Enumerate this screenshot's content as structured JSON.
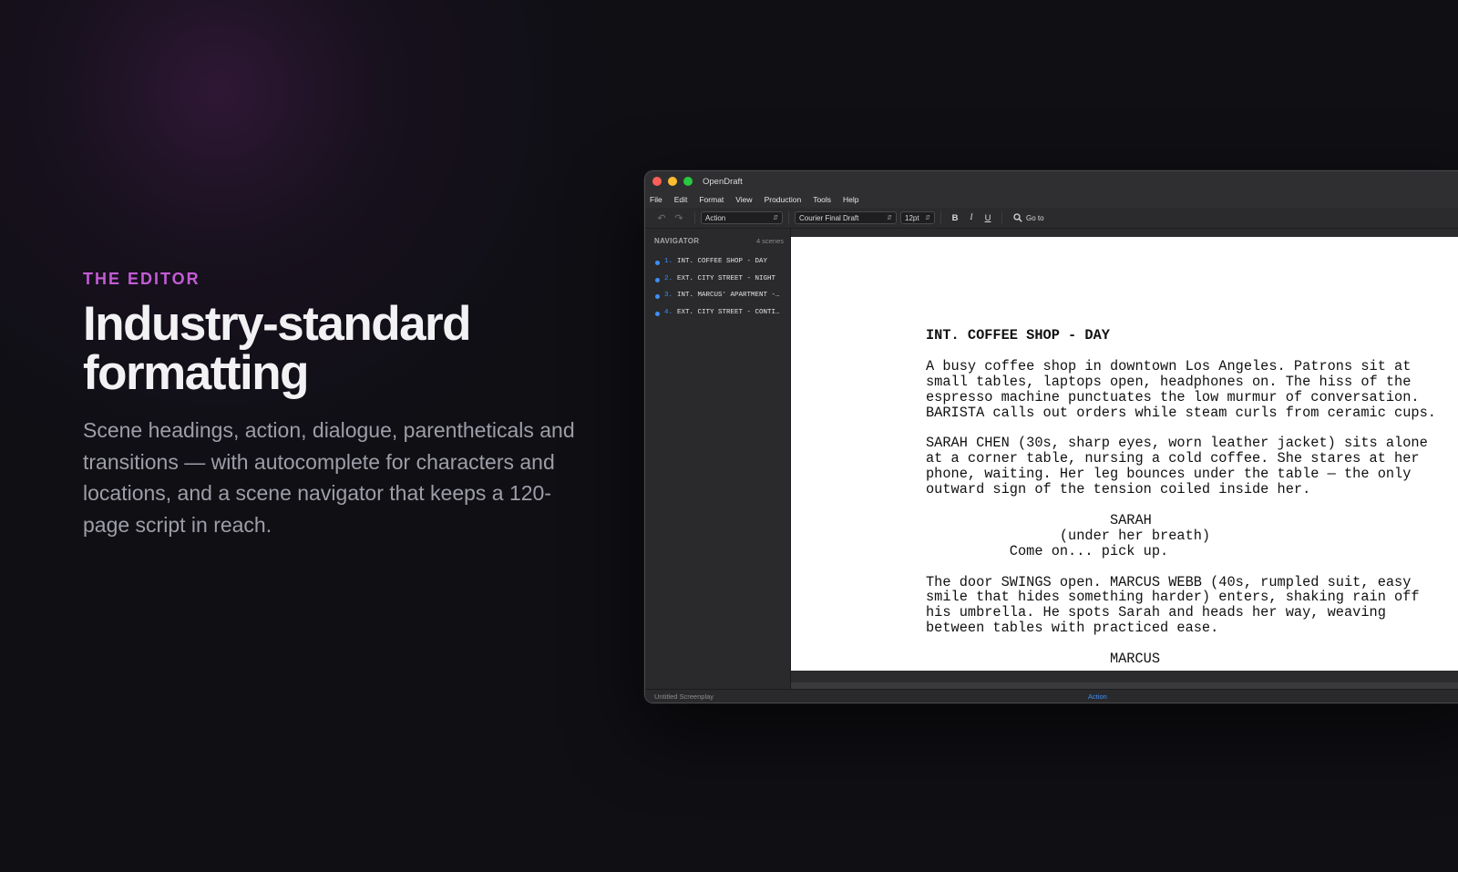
{
  "hero": {
    "eyebrow": "THE EDITOR",
    "headline_line1": "Industry-standard",
    "headline_line2": "formatting",
    "body": "Scene headings, action, dialogue, parentheticals and transitions — with autocomplete for characters and locations, and a scene navigator that keeps a 120-page script in reach."
  },
  "window": {
    "title": "OpenDraft",
    "traffic_lights": [
      "close",
      "minimize",
      "zoom"
    ]
  },
  "menu": [
    "File",
    "Edit",
    "Format",
    "View",
    "Production",
    "Tools",
    "Help"
  ],
  "toolbar": {
    "undo_icon": "undo-icon",
    "redo_icon": "redo-icon",
    "element_type": "Action",
    "font": "Courier Final Draft",
    "font_size": "12pt",
    "bold": "B",
    "italic": "I",
    "underline": "U",
    "search_icon": "search-icon",
    "goto_label": "Go to"
  },
  "navigator": {
    "title": "NAVIGATOR",
    "count": "4 scenes",
    "scenes": [
      {
        "num": "1.",
        "name": "INT. COFFEE SHOP - DAY"
      },
      {
        "num": "2.",
        "name": "EXT. CITY STREET - NIGHT"
      },
      {
        "num": "3.",
        "name": "INT. MARCUS' APARTMENT - NIGHT"
      },
      {
        "num": "4.",
        "name": "EXT. CITY STREET - CONTINUOUS"
      }
    ]
  },
  "script": {
    "heading": "INT. COFFEE SHOP - DAY",
    "action1": [
      "A busy coffee shop in downtown Los Angeles. Patrons sit at",
      "small tables, laptops open, headphones on. The hiss of the",
      "espresso machine punctuates the low murmur of conversation.",
      "BARISTA calls out orders while steam curls from ceramic cups."
    ],
    "action2": [
      "SARAH CHEN (30s, sharp eyes, worn leather jacket) sits alone",
      "at a corner table, nursing a cold coffee. She stares at her",
      "phone, waiting. Her leg bounces under the table — the only",
      "outward sign of the tension coiled inside her."
    ],
    "character1": "SARAH",
    "parenthetical1": "(under her breath)",
    "dialogue1": "Come on... pick up.",
    "action3": [
      "The door SWINGS open. MARCUS WEBB (40s, rumpled suit, easy",
      "smile that hides something harder) enters, shaking rain off",
      "his umbrella. He spots Sarah and heads her way, weaving",
      "between tables with practiced ease."
    ],
    "character2": "MARCUS"
  },
  "status": {
    "document": "Untitled Screenplay",
    "mode": "Action"
  }
}
